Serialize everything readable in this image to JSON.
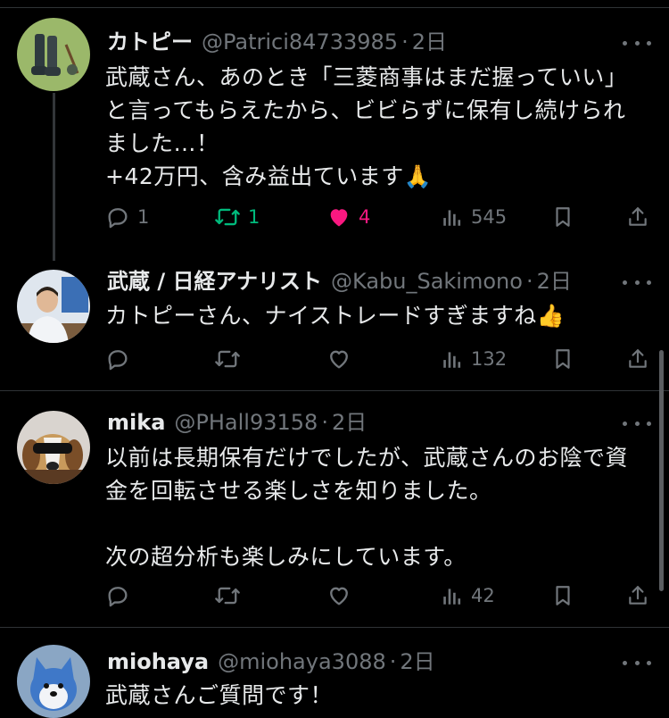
{
  "tweets": [
    {
      "name": "カトピー",
      "handle": "@Patrici84733985",
      "sep": "·",
      "time": "2日",
      "text": "武蔵さん、あのとき「三菱商事はまだ握っていい」\nと言ってもらえたから、ビビらずに保有し続けられ\nました…！\n+42万円、含み益出ています🙏",
      "replies": "1",
      "retweets": "1",
      "likes": "4",
      "views": "545"
    },
    {
      "name": "武蔵 / 日経アナリスト",
      "handle": "@Kabu_Sakimono",
      "sep": "·",
      "time": "2日",
      "text": "カトピーさん、ナイストレードすぎますね👍",
      "replies": "",
      "retweets": "",
      "likes": "",
      "views": "132"
    },
    {
      "name": "mika",
      "handle": "@PHall93158",
      "sep": "·",
      "time": "2日",
      "text": "以前は長期保有だけでしたが、武蔵さんのお陰で資\n金を回転させる楽しさを知りました。\n\n次の超分析も楽しみにしています。",
      "replies": "",
      "retweets": "",
      "likes": "",
      "views": "42"
    },
    {
      "name": "miohaya",
      "handle": "@miohaya3088",
      "sep": "·",
      "time": "2日",
      "text": "武蔵さんご質問です！"
    }
  ],
  "icons": {
    "reply": "reply-icon",
    "retweet": "retweet-icon",
    "like": "heart-icon",
    "views": "views-icon",
    "bookmark": "bookmark-icon",
    "share": "share-icon",
    "more": "more-icon"
  },
  "colors": {
    "background": "#000000",
    "text": "#e7e9ea",
    "secondary": "#71767b",
    "retweet_active": "#00ba7c",
    "like_active": "#f91880"
  }
}
